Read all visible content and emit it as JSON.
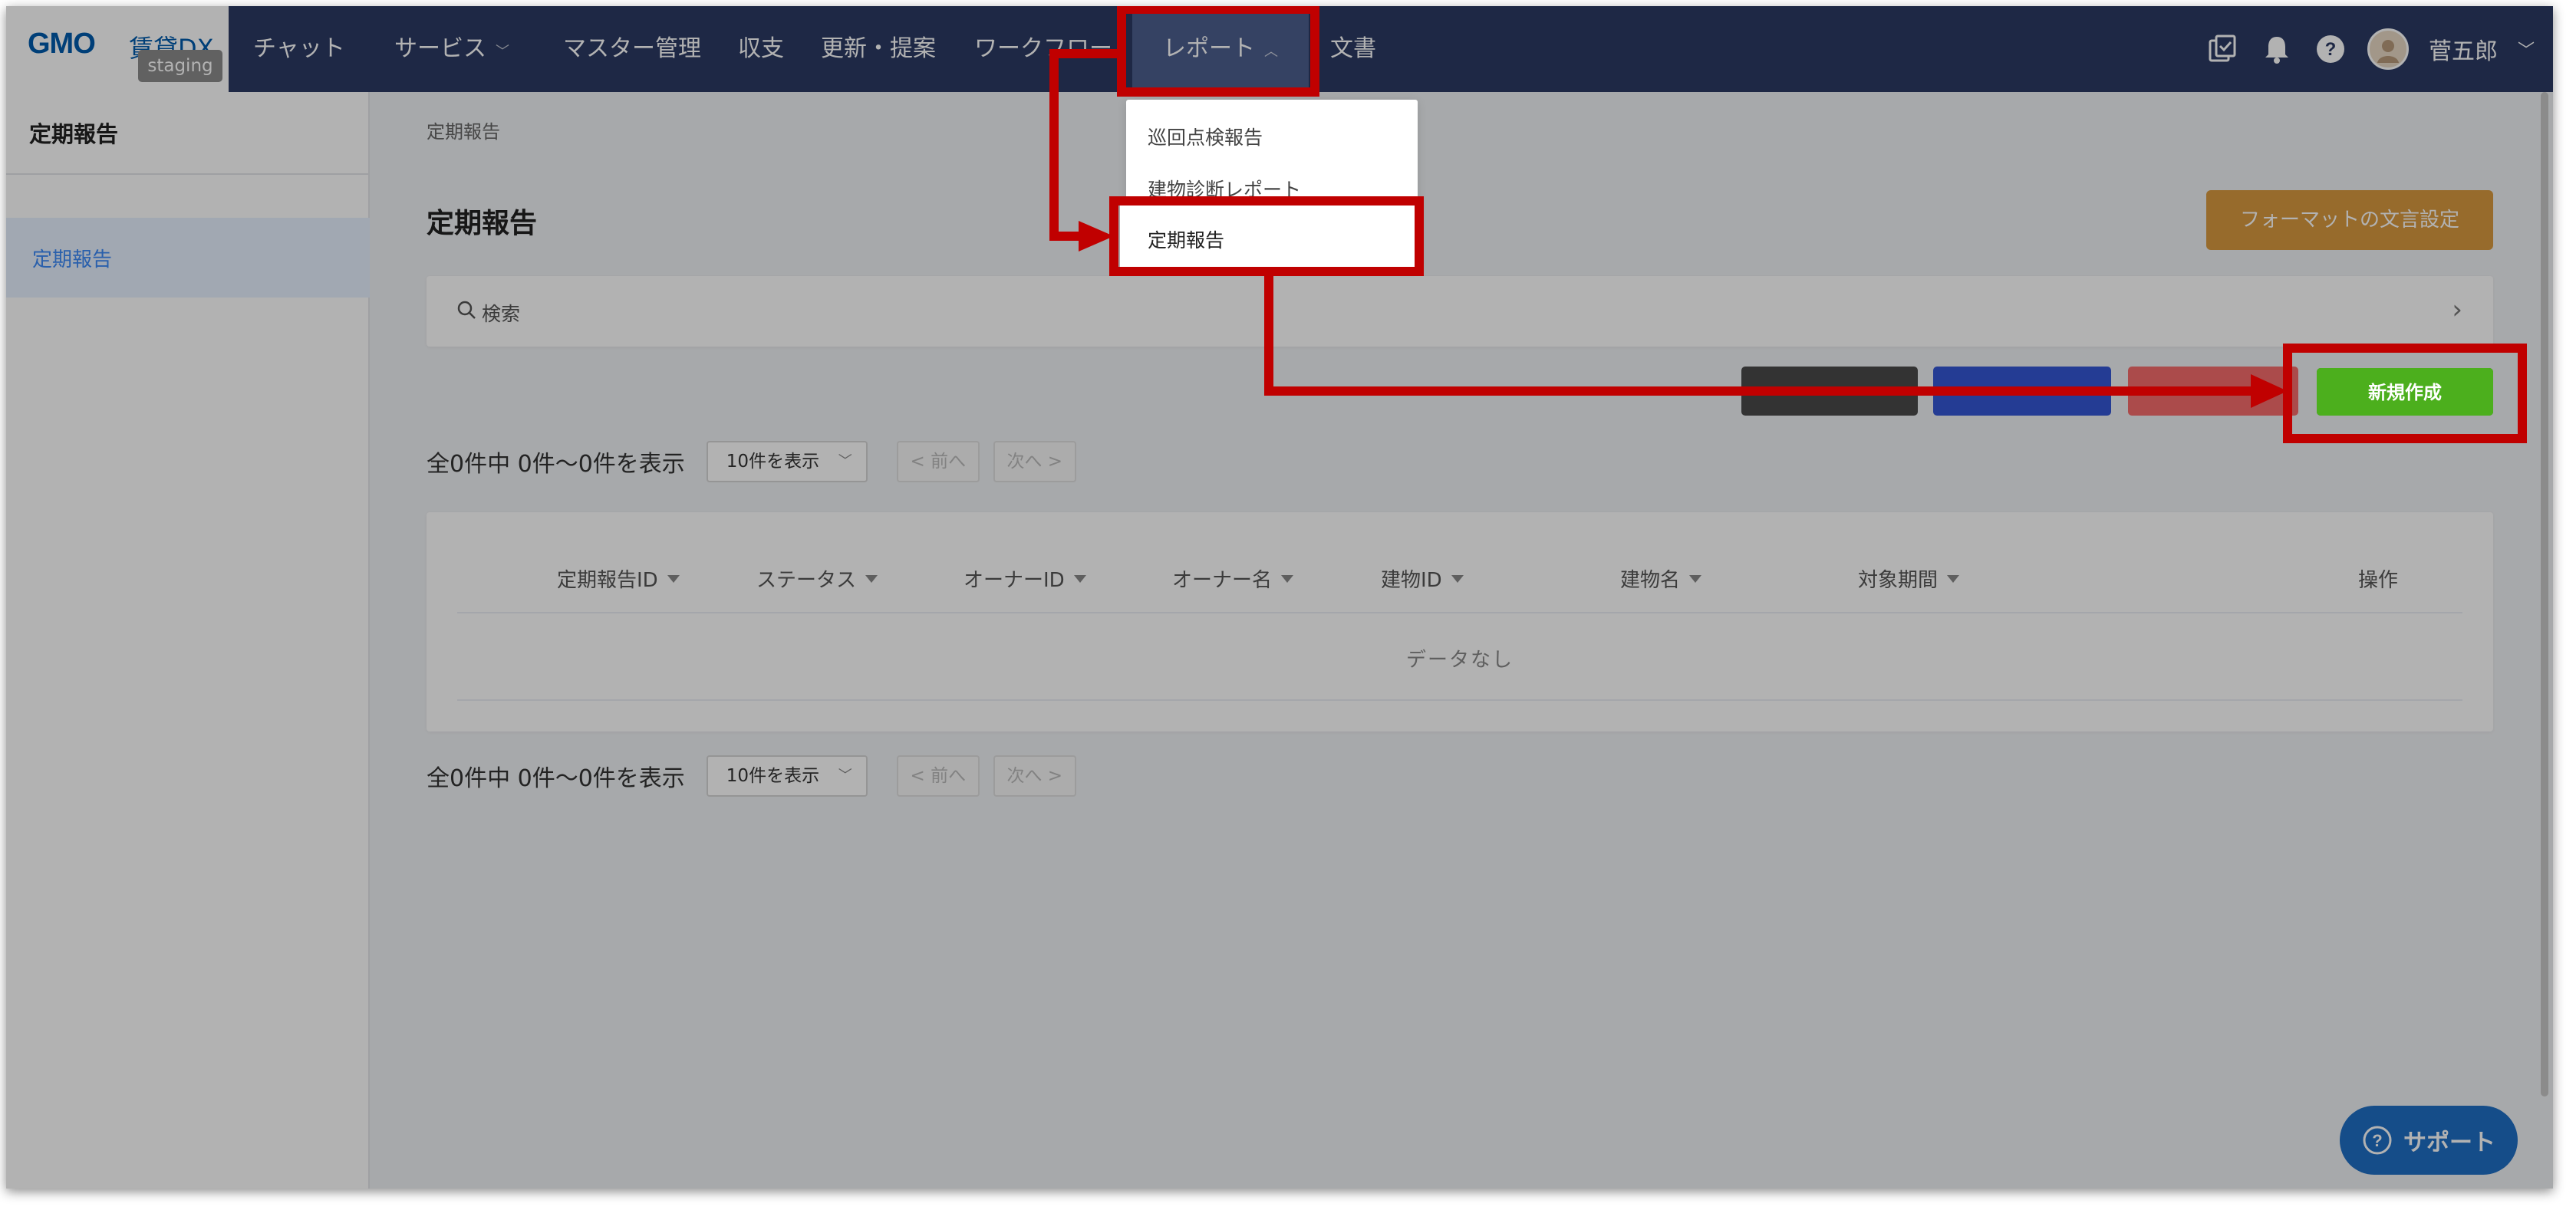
{
  "logo": {
    "brand": "GMO",
    "product": "賃貸DX",
    "env_badge": "staging"
  },
  "nav": {
    "items": [
      {
        "label": "チャット",
        "chevron": false
      },
      {
        "label": "サービス",
        "chevron": true
      },
      {
        "label": "マスター管理",
        "chevron": false
      },
      {
        "label": "収支",
        "chevron": false
      },
      {
        "label": "更新・提案",
        "chevron": false
      },
      {
        "label": "ワークフロー",
        "chevron": false
      },
      {
        "label": "レポート",
        "chevron": true,
        "active": true
      },
      {
        "label": "文書",
        "chevron": false
      }
    ],
    "icons": [
      "task-check-icon",
      "bell-icon",
      "help-circle-icon"
    ],
    "user_name": "菅五郎"
  },
  "sidebar": {
    "title": "定期報告",
    "items": [
      {
        "label": "定期報告",
        "active": true
      }
    ]
  },
  "report_menu": {
    "items": [
      "巡回点検報告",
      "建物診断レポート",
      "定期報告"
    ],
    "highlighted": "定期報告"
  },
  "main": {
    "breadcrumb": "定期報告",
    "title": "定期報告",
    "format_button": "フォーマットの文言設定",
    "search_label": "検索",
    "action_buttons": [
      {
        "label": "",
        "color": "#4a4a4a"
      },
      {
        "label": "",
        "color": "#3457d5"
      },
      {
        "label": "",
        "color": "#f56c6c"
      }
    ],
    "new_button": "新規作成",
    "pager": {
      "summary": "全0件中 0件～0件を表示",
      "page_size": "10件を表示",
      "prev": "< 前へ",
      "next": "次へ >"
    },
    "table": {
      "columns": [
        "定期報告ID",
        "ステータス",
        "オーナーID",
        "オーナー名",
        "建物ID",
        "建物名",
        "対象期間",
        "操作"
      ],
      "empty_text": "データなし"
    }
  },
  "support_button": "サポート",
  "colors": {
    "nav_bg": "#2b3a63",
    "nav_active": "#4d5f8e",
    "accent_blue": "#3d8af7",
    "format_button": "#d89a3f",
    "new_button": "#4caf1d",
    "annotation_red": "#c00000",
    "support": "#1f6fc4"
  }
}
